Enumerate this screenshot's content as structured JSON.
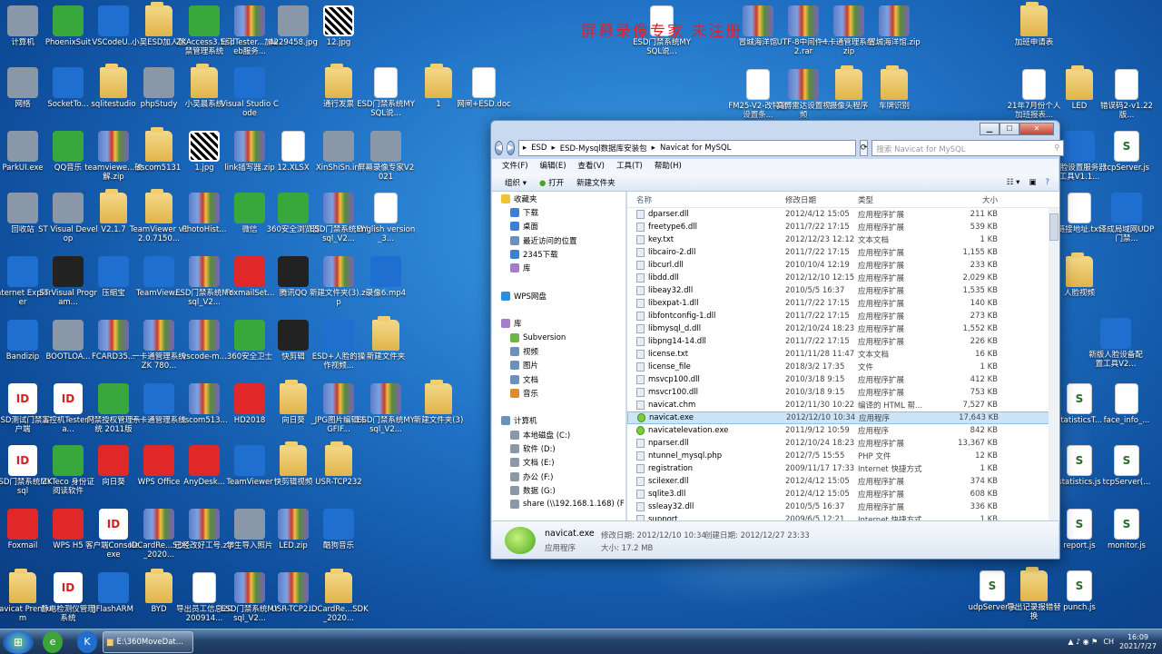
{
  "watermark": "屏幕录像专家 未注册",
  "desktop": [
    {
      "label": "计算机",
      "type": "gray"
    },
    {
      "label": "PhoenixSuit",
      "type": "green"
    },
    {
      "label": "VSCodeU...",
      "type": "blue"
    },
    {
      "label": "小吴ESD加人脸",
      "type": "folder"
    },
    {
      "label": "ZKAccess3.5门禁管理系统",
      "type": "green"
    },
    {
      "label": "EsdTester...加web服务...",
      "type": "zip"
    },
    {
      "label": "4229458.jpg",
      "type": "gray"
    },
    {
      "label": "12.jpg",
      "type": "qr"
    },
    {
      "label": "网络",
      "type": "gray"
    },
    {
      "label": "SocketTo...",
      "type": "blue"
    },
    {
      "label": "sqlitestudio",
      "type": "folder"
    },
    {
      "label": "phpStudy",
      "type": "gray"
    },
    {
      "label": "小吴晨系统",
      "type": "folder"
    },
    {
      "label": "Visual Studio Code",
      "type": "blue"
    },
    {
      "label": "通行发票",
      "type": "folder"
    },
    {
      "label": "ESD门禁系统MYSQL说...",
      "type": "doc"
    },
    {
      "label": "1",
      "type": "folder"
    },
    {
      "label": "网闸+ESD.doc",
      "type": "doc"
    },
    {
      "label": "ParkUI.exe",
      "type": "gray"
    },
    {
      "label": "QQ音乐",
      "type": "green"
    },
    {
      "label": "teamviewe...破解.zip",
      "type": "zip"
    },
    {
      "label": "sscom5131",
      "type": "folder"
    },
    {
      "label": "1.jpg",
      "type": "qr"
    },
    {
      "label": "link插写器.zip",
      "type": "zip"
    },
    {
      "label": "12.XLSX",
      "type": "doc"
    },
    {
      "label": "XinShiSn.ini",
      "type": "gray"
    },
    {
      "label": "屏幕录像专家V2021",
      "type": "gray"
    },
    {
      "label": "回收站",
      "type": "gray"
    },
    {
      "label": "ST Visual Develop",
      "type": "gray"
    },
    {
      "label": "V2.1.7",
      "type": "folder"
    },
    {
      "label": "TeamViewer v12.0.7150...",
      "type": "folder"
    },
    {
      "label": "PhotoHist...",
      "type": "zip"
    },
    {
      "label": "微信",
      "type": "green"
    },
    {
      "label": "360安全浏览器",
      "type": "green"
    },
    {
      "label": "ESD门禁系统MYsql_V2...",
      "type": "zip"
    },
    {
      "label": "English version_3...",
      "type": "doc"
    },
    {
      "label": "Internet Explorer",
      "type": "blue"
    },
    {
      "label": "ST Visual Program...",
      "type": "dark"
    },
    {
      "label": "压缩宝",
      "type": "blue"
    },
    {
      "label": "TeamView...",
      "type": "blue"
    },
    {
      "label": "ESD门禁系统MYsql_V2...",
      "type": "zip"
    },
    {
      "label": "FoxmailSet...",
      "type": "red"
    },
    {
      "label": "腾讯QQ",
      "type": "dark"
    },
    {
      "label": "新建文件夹(3).zip",
      "type": "zip"
    },
    {
      "label": "录像6.mp4",
      "type": "blue"
    },
    {
      "label": "Bandizip",
      "type": "blue"
    },
    {
      "label": "BOOTLOA...",
      "type": "gray"
    },
    {
      "label": "FCARD35...",
      "type": "zip"
    },
    {
      "label": "一卡通管理系统 ZK 780...",
      "type": "zip"
    },
    {
      "label": "vscode-m...",
      "type": "zip"
    },
    {
      "label": "360安全卫士",
      "type": "green"
    },
    {
      "label": "快剪辑",
      "type": "dark"
    },
    {
      "label": "ESD+人脸的操作视频...",
      "type": "blue"
    },
    {
      "label": "新建文件夹",
      "type": "folder"
    },
    {
      "label": "ESD测试门禁客户端",
      "type": "esd"
    },
    {
      "label": "工控机TesterMa...",
      "type": "esd"
    },
    {
      "label": "门禁授权管理系统 2011版",
      "type": "green"
    },
    {
      "label": "一卡通管理系统",
      "type": "blue"
    },
    {
      "label": "sscom513...",
      "type": "zip"
    },
    {
      "label": "HD2018",
      "type": "red"
    },
    {
      "label": "向日葵",
      "type": "folder"
    },
    {
      "label": "_JPG图片编辑未GFIF...",
      "type": "zip"
    },
    {
      "label": "ESD门禁系统MYsql_V2...",
      "type": "zip"
    },
    {
      "label": "新建文件夹(3)",
      "type": "folder"
    },
    {
      "label": "ESD门禁系统MYsql",
      "type": "esd"
    },
    {
      "label": "ZKTeco 身份证阅读软件",
      "type": "green"
    },
    {
      "label": "向日葵",
      "type": "red"
    },
    {
      "label": "WPS Office",
      "type": "red"
    },
    {
      "label": "AnyDesk...",
      "type": "red"
    },
    {
      "label": "TeamViewer",
      "type": "blue"
    },
    {
      "label": "快剪辑视频",
      "type": "folder"
    },
    {
      "label": "USR-TCP232",
      "type": "folder"
    },
    {
      "label": "Foxmail",
      "type": "red"
    },
    {
      "label": "WPS H5",
      "type": "red"
    },
    {
      "label": "客户端Console.exe",
      "type": "esd"
    },
    {
      "label": "IDCardRe...SDK_2020...",
      "type": "zip"
    },
    {
      "label": "已经改好工号.zip",
      "type": "zip"
    },
    {
      "label": "学生导入照片",
      "type": "gray"
    },
    {
      "label": "LED.zip",
      "type": "zip"
    },
    {
      "label": "酷狗音乐",
      "type": "blue"
    },
    {
      "label": "Navicat Premium",
      "type": "folder"
    },
    {
      "label": "静电检测仪管理系统",
      "type": "esd"
    },
    {
      "label": "JFlashARM",
      "type": "blue"
    },
    {
      "label": "BYD",
      "type": "folder"
    },
    {
      "label": "导出员工信息20200914...",
      "type": "doc"
    },
    {
      "label": "ESD门禁系统MYsql_V2...",
      "type": "zip"
    },
    {
      "label": "USR-TCP2...",
      "type": "zip"
    },
    {
      "label": "IDCardRe...SDK_2020...",
      "type": "folder"
    },
    {
      "label": "ESD门禁系统MYSQL说...",
      "type": "doc"
    },
    {
      "label": "冒城海洋馆",
      "type": "zip"
    },
    {
      "label": "UTF-8中间件4.2.rar",
      "type": "zip"
    },
    {
      "label": "一卡通管理系统.zip",
      "type": "zip"
    },
    {
      "label": "冒城海洋馆.zip",
      "type": "zip"
    },
    {
      "label": "加班申请表",
      "type": "folder"
    },
    {
      "label": "FM25-V2-改特谢设置条...",
      "type": "doc"
    },
    {
      "label": "高博雷达设置视频",
      "type": "zip"
    },
    {
      "label": "摄像头程序",
      "type": "folder"
    },
    {
      "label": "车牌识别",
      "type": "folder"
    },
    {
      "label": "21年7月份个人加班报表...",
      "type": "doc"
    },
    {
      "label": "LED",
      "type": "folder"
    },
    {
      "label": "错误码2-v1.22版...",
      "type": "doc"
    },
    {
      "label": "人脸设置服务器工具V1.1...",
      "type": "blue"
    },
    {
      "label": "tcpServer.js",
      "type": "js"
    },
    {
      "label": "链接地址.txt",
      "type": "doc"
    },
    {
      "label": "泽成局域网UDP门禁...",
      "type": "blue"
    },
    {
      "label": "人脸视频",
      "type": "folder"
    },
    {
      "label": "新版人脸设备配置工具V2...",
      "type": "blue"
    },
    {
      "label": "statisticsT...",
      "type": "js"
    },
    {
      "label": "face_info_...",
      "type": "doc"
    },
    {
      "label": "statistics.js",
      "type": "js"
    },
    {
      "label": "tcpServer(...",
      "type": "js"
    },
    {
      "label": "report.js",
      "type": "js"
    },
    {
      "label": "monitor.js",
      "type": "js"
    },
    {
      "label": "udpServer.js",
      "type": "js"
    },
    {
      "label": "导出记录报错替换",
      "type": "folder"
    },
    {
      "label": "punch.js",
      "type": "js"
    }
  ],
  "explorer": {
    "path": [
      "ESD",
      "ESD-Mysql数据库安装包",
      "Navicat for MySQL"
    ],
    "search_placeholder": "搜索 Navicat for MySQL",
    "menu": [
      "文件(F)",
      "编辑(E)",
      "查看(V)",
      "工具(T)",
      "帮助(H)"
    ],
    "toolbar": {
      "organize": "组织 ▾",
      "open": "打开",
      "new_folder": "新建文件夹"
    },
    "nav": [
      "收藏夹",
      "下载",
      "桌面",
      "最近访问的位置",
      "2345下载",
      "库",
      "",
      "WPS网盘",
      "",
      "库",
      "Subversion",
      "视频",
      "图片",
      "文档",
      "音乐",
      "",
      "计算机",
      "本地磁盘 (C:)",
      "软件 (D:)",
      "文档 (E:)",
      "办公 (F:)",
      "数据 (G:)",
      "share (\\\\192.168.1.168) (F"
    ],
    "columns": [
      "名称",
      "修改日期",
      "类型",
      "大小"
    ],
    "files": [
      [
        "dparser.dll",
        "2012/4/12 15:05",
        "应用程序扩展",
        "211 KB"
      ],
      [
        "freetype6.dll",
        "2011/7/22 17:15",
        "应用程序扩展",
        "539 KB"
      ],
      [
        "key.txt",
        "2012/12/23 12:12",
        "文本文档",
        "1 KB"
      ],
      [
        "libcairo-2.dll",
        "2011/7/22 17:15",
        "应用程序扩展",
        "1,155 KB"
      ],
      [
        "libcurl.dll",
        "2010/10/4 12:19",
        "应用程序扩展",
        "233 KB"
      ],
      [
        "libdd.dll",
        "2012/12/10 12:15",
        "应用程序扩展",
        "2,029 KB"
      ],
      [
        "libeay32.dll",
        "2010/5/5 16:37",
        "应用程序扩展",
        "1,535 KB"
      ],
      [
        "libexpat-1.dll",
        "2011/7/22 17:15",
        "应用程序扩展",
        "140 KB"
      ],
      [
        "libfontconfig-1.dll",
        "2011/7/22 17:15",
        "应用程序扩展",
        "273 KB"
      ],
      [
        "libmysql_d.dll",
        "2012/10/24 18:23",
        "应用程序扩展",
        "1,552 KB"
      ],
      [
        "libpng14-14.dll",
        "2011/7/22 17:15",
        "应用程序扩展",
        "226 KB"
      ],
      [
        "license.txt",
        "2011/11/28 11:47",
        "文本文档",
        "16 KB"
      ],
      [
        "license_file",
        "2018/3/2 17:35",
        "文件",
        "1 KB"
      ],
      [
        "msvcp100.dll",
        "2010/3/18 9:15",
        "应用程序扩展",
        "412 KB"
      ],
      [
        "msvcr100.dll",
        "2010/3/18 9:15",
        "应用程序扩展",
        "753 KB"
      ],
      [
        "navicat.chm",
        "2012/11/30 10:22",
        "编译的 HTML 帮...",
        "7,527 KB"
      ],
      [
        "navicat.exe",
        "2012/12/10 10:34",
        "应用程序",
        "17,643 KB"
      ],
      [
        "navicatelevation.exe",
        "2011/9/12 10:59",
        "应用程序",
        "842 KB"
      ],
      [
        "nparser.dll",
        "2012/10/24 18:23",
        "应用程序扩展",
        "13,367 KB"
      ],
      [
        "ntunnel_mysql.php",
        "2012/7/5 15:55",
        "PHP 文件",
        "12 KB"
      ],
      [
        "registration",
        "2009/11/17 17:33",
        "Internet 快捷方式",
        "1 KB"
      ],
      [
        "scilexer.dll",
        "2012/4/12 15:05",
        "应用程序扩展",
        "374 KB"
      ],
      [
        "sqlite3.dll",
        "2012/4/12 15:05",
        "应用程序扩展",
        "608 KB"
      ],
      [
        "ssleay32.dll",
        "2010/5/5 16:37",
        "应用程序扩展",
        "336 KB"
      ],
      [
        "support",
        "2009/6/5 12:21",
        "Internet 快捷方式",
        "1 KB"
      ]
    ],
    "selected_index": 16,
    "details": {
      "name": "navicat.exe",
      "modified": "修改日期: 2012/12/10 10:34",
      "created": "创建日期: 2012/12/27 23:33",
      "type": "应用程序",
      "size": "大小: 17.2 MB"
    }
  },
  "taskbar": {
    "task": "E:\\360MoveDat...",
    "time": "16:09",
    "date": "2021/7/27",
    "lang": "CH"
  }
}
